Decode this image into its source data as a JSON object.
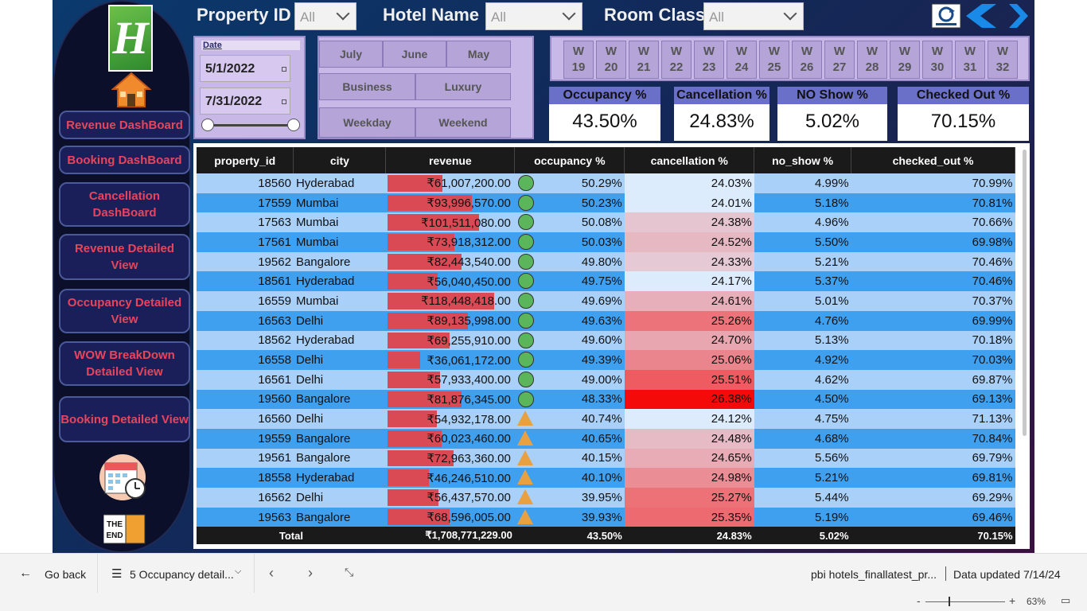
{
  "filters": {
    "property_id_label": "Property ID",
    "property_id_value": "All",
    "hotel_name_label": "Hotel Name",
    "hotel_name_value": "All",
    "room_class_label": "Room Class",
    "room_class_value": "All"
  },
  "sidebar": {
    "logo_letter": "H",
    "items": [
      {
        "label": "Revenue DashBoard"
      },
      {
        "label": "Booking DashBoard"
      },
      {
        "label": "Cancellation DashBoard"
      },
      {
        "label": "Revenue Detailed View"
      },
      {
        "label": "Occupancy Detailed View"
      },
      {
        "label": "WOW BreakDown Detailed View"
      },
      {
        "label": "Booking Detailed View"
      }
    ],
    "end_icon_text_1": "THE",
    "end_icon_text_2": "END"
  },
  "date_filter": {
    "label": "Date",
    "start": "5/1/2022",
    "end": "7/31/2022"
  },
  "month_buttons": [
    "July",
    "June",
    "May"
  ],
  "class_buttons": [
    "Business",
    "Luxury"
  ],
  "daytype_buttons": [
    "Weekday",
    "Weekend"
  ],
  "weeks": [
    {
      "w": "W",
      "n": "19"
    },
    {
      "w": "W",
      "n": "20"
    },
    {
      "w": "W",
      "n": "21"
    },
    {
      "w": "W",
      "n": "22"
    },
    {
      "w": "W",
      "n": "23"
    },
    {
      "w": "W",
      "n": "24"
    },
    {
      "w": "W",
      "n": "25"
    },
    {
      "w": "W",
      "n": "26"
    },
    {
      "w": "W",
      "n": "27"
    },
    {
      "w": "W",
      "n": "28"
    },
    {
      "w": "W",
      "n": "29"
    },
    {
      "w": "W",
      "n": "30"
    },
    {
      "w": "W",
      "n": "31"
    },
    {
      "w": "W",
      "n": "32"
    }
  ],
  "kpis": [
    {
      "title": "Occupancy %",
      "value": "43.50%"
    },
    {
      "title": "Cancellation %",
      "value": "24.83%"
    },
    {
      "title": "NO Show %",
      "value": "5.02%"
    },
    {
      "title": "Checked Out %",
      "value": "70.15%"
    }
  ],
  "table": {
    "columns": [
      "property_id",
      "city",
      "revenue",
      "occupancy %",
      "cancellation %",
      "no_show %",
      "checked_out %"
    ],
    "rows": [
      {
        "id": "18560",
        "city": "Hyderabad",
        "rev": "₹61,007,200.00",
        "rev_val": 61007200,
        "occ": "50.29%",
        "ind": "circle",
        "can": "24.03%",
        "can_val": 24.03,
        "ns": "4.99%",
        "co": "70.99%"
      },
      {
        "id": "17559",
        "city": "Mumbai",
        "rev": "₹93,996,570.00",
        "rev_val": 93996570,
        "occ": "50.23%",
        "ind": "circle",
        "can": "24.01%",
        "can_val": 24.01,
        "ns": "5.18%",
        "co": "70.81%"
      },
      {
        "id": "17563",
        "city": "Mumbai",
        "rev": "₹101,511,080.00",
        "rev_val": 101511080,
        "occ": "50.08%",
        "ind": "circle",
        "can": "24.38%",
        "can_val": 24.38,
        "ns": "4.96%",
        "co": "70.66%"
      },
      {
        "id": "17561",
        "city": "Mumbai",
        "rev": "₹73,918,312.00",
        "rev_val": 73918312,
        "occ": "50.03%",
        "ind": "circle",
        "can": "24.52%",
        "can_val": 24.52,
        "ns": "5.50%",
        "co": "69.98%"
      },
      {
        "id": "19562",
        "city": "Bangalore",
        "rev": "₹82,443,540.00",
        "rev_val": 82443540,
        "occ": "49.80%",
        "ind": "circle",
        "can": "24.33%",
        "can_val": 24.33,
        "ns": "5.21%",
        "co": "70.46%"
      },
      {
        "id": "18561",
        "city": "Hyderabad",
        "rev": "₹56,040,450.00",
        "rev_val": 56040450,
        "occ": "49.75%",
        "ind": "circle",
        "can": "24.17%",
        "can_val": 24.17,
        "ns": "5.37%",
        "co": "70.46%"
      },
      {
        "id": "16559",
        "city": "Mumbai",
        "rev": "₹118,448,418.00",
        "rev_val": 118448418,
        "occ": "49.69%",
        "ind": "circle",
        "can": "24.61%",
        "can_val": 24.61,
        "ns": "5.01%",
        "co": "70.37%"
      },
      {
        "id": "16563",
        "city": "Delhi",
        "rev": "₹89,135,998.00",
        "rev_val": 89135998,
        "occ": "49.63%",
        "ind": "circle",
        "can": "25.26%",
        "can_val": 25.26,
        "ns": "4.76%",
        "co": "69.99%"
      },
      {
        "id": "18562",
        "city": "Hyderabad",
        "rev": "₹69,255,910.00",
        "rev_val": 69255910,
        "occ": "49.60%",
        "ind": "circle",
        "can": "24.70%",
        "can_val": 24.7,
        "ns": "5.13%",
        "co": "70.18%"
      },
      {
        "id": "16558",
        "city": "Delhi",
        "rev": "₹36,061,172.00",
        "rev_val": 36061172,
        "occ": "49.39%",
        "ind": "circle",
        "can": "25.06%",
        "can_val": 25.06,
        "ns": "4.92%",
        "co": "70.03%"
      },
      {
        "id": "16561",
        "city": "Delhi",
        "rev": "₹57,933,400.00",
        "rev_val": 57933400,
        "occ": "49.00%",
        "ind": "circle",
        "can": "25.51%",
        "can_val": 25.51,
        "ns": "4.62%",
        "co": "69.87%"
      },
      {
        "id": "19560",
        "city": "Bangalore",
        "rev": "₹81,876,345.00",
        "rev_val": 81876345,
        "occ": "48.33%",
        "ind": "circle",
        "can": "26.38%",
        "can_val": 26.38,
        "ns": "4.50%",
        "co": "69.13%"
      },
      {
        "id": "16560",
        "city": "Delhi",
        "rev": "₹54,932,178.00",
        "rev_val": 54932178,
        "occ": "40.74%",
        "ind": "triangle",
        "can": "24.12%",
        "can_val": 24.12,
        "ns": "4.75%",
        "co": "71.13%"
      },
      {
        "id": "19559",
        "city": "Bangalore",
        "rev": "₹60,023,460.00",
        "rev_val": 60023460,
        "occ": "40.65%",
        "ind": "triangle",
        "can": "24.48%",
        "can_val": 24.48,
        "ns": "4.68%",
        "co": "70.84%"
      },
      {
        "id": "19561",
        "city": "Bangalore",
        "rev": "₹72,963,360.00",
        "rev_val": 72963360,
        "occ": "40.15%",
        "ind": "triangle",
        "can": "24.65%",
        "can_val": 24.65,
        "ns": "5.56%",
        "co": "69.79%"
      },
      {
        "id": "18558",
        "city": "Hyderabad",
        "rev": "₹46,246,510.00",
        "rev_val": 46246510,
        "occ": "40.10%",
        "ind": "triangle",
        "can": "24.98%",
        "can_val": 24.98,
        "ns": "5.21%",
        "co": "69.81%"
      },
      {
        "id": "16562",
        "city": "Delhi",
        "rev": "₹56,437,570.00",
        "rev_val": 56437570,
        "occ": "39.95%",
        "ind": "triangle",
        "can": "25.27%",
        "can_val": 25.27,
        "ns": "5.44%",
        "co": "69.29%"
      },
      {
        "id": "19563",
        "city": "Bangalore",
        "rev": "₹68,596,005.00",
        "rev_val": 68596005,
        "occ": "39.93%",
        "ind": "triangle",
        "can": "25.35%",
        "can_val": 25.35,
        "ns": "5.19%",
        "co": "69.46%"
      }
    ],
    "total": {
      "label": "Total",
      "rev": "₹1,708,771,229.00",
      "occ": "43.50%",
      "can": "24.83%",
      "ns": "5.02%",
      "co": "70.15%"
    }
  },
  "bottom": {
    "go_back": "Go back",
    "page_name": "5 Occupancy detail...",
    "report_name": "pbi hotels_finallatest_pr...",
    "data_updated": "Data updated 7/14/24",
    "zoom": "63%"
  },
  "colors": {
    "row_light": "#a8d0f8",
    "row_dark": "#3fa0f0",
    "revenue_bar": "#d94a55",
    "kpi_title": "#6a6fc8",
    "nav_text": "#e8455b"
  }
}
